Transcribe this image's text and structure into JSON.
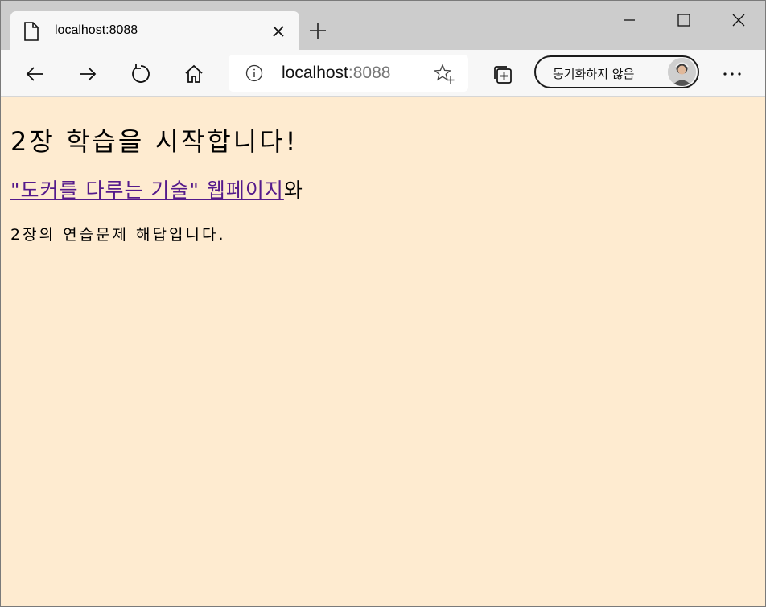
{
  "tab": {
    "title": "localhost:8088",
    "page_icon": "page-icon",
    "close_icon": "close-icon"
  },
  "new_tab_icon": "plus-icon",
  "window_controls": [
    "minimize-icon",
    "maximize-icon",
    "close-icon"
  ],
  "toolbar": {
    "back_icon": "back-arrow-icon",
    "forward_icon": "forward-arrow-icon",
    "refresh_icon": "refresh-icon",
    "home_icon": "home-icon",
    "address": {
      "info_icon": "info-icon",
      "host": "localhost",
      "port": ":8088",
      "favorite_icon": "star-add-icon"
    },
    "collections_icon": "collections-icon",
    "profile": {
      "label": "동기화하지 않음"
    },
    "more_icon": "more-icon"
  },
  "page": {
    "background": "#feebd0",
    "heading": "2장 학습을 시작합니다!",
    "link_text": "\"도커를 다루는 기술\" 웹페이지",
    "after_link": "와",
    "paragraph": "2장의 연습문제 해답입니다."
  },
  "colors": {
    "chrome": "#cccccc",
    "toolbar": "#f7f7f7",
    "link": "#551a8b"
  }
}
